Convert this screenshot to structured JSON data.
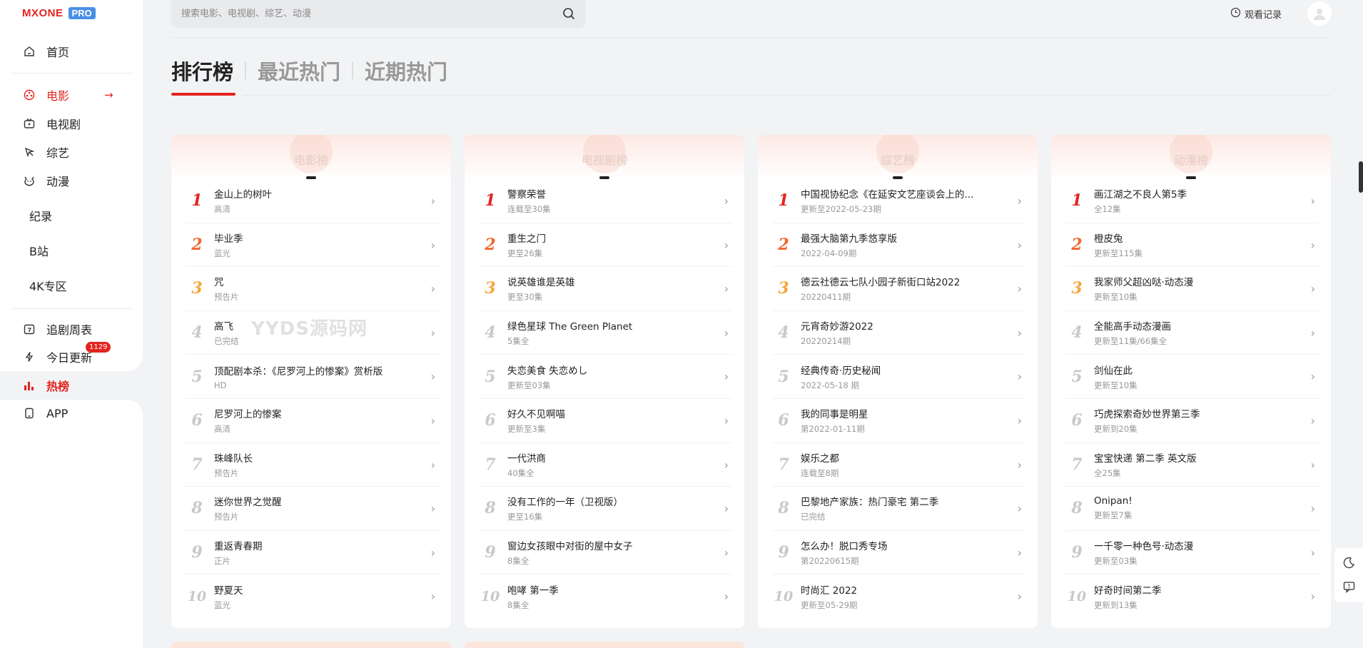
{
  "sidebar": {
    "logo": "MXONE",
    "logo_badge": "PRO",
    "items": [
      {
        "label": "首页",
        "icon": "home-icon"
      },
      {
        "label": "电影",
        "icon": "film-icon"
      },
      {
        "label": "电视剧",
        "icon": "tv-icon"
      },
      {
        "label": "综艺",
        "icon": "variety-icon"
      },
      {
        "label": "动漫",
        "icon": "anime-icon"
      },
      {
        "label": "纪录"
      },
      {
        "label": "B站"
      },
      {
        "label": "4K专区"
      },
      {
        "label": "追剧周表",
        "icon": "calendar-icon"
      },
      {
        "label": "今日更新",
        "icon": "lightning-icon",
        "badge": "1129"
      },
      {
        "label": "热榜",
        "icon": "chart-icon"
      },
      {
        "label": "APP",
        "icon": "phone-icon"
      }
    ]
  },
  "header": {
    "search_placeholder": "搜索电影、电视剧、综艺、动漫",
    "history_label": "观看记录"
  },
  "tabs": [
    "排行榜",
    "最近热门",
    "近期热门"
  ],
  "watermark": "YYDS源码网",
  "colors": {
    "accent": "#e4231e",
    "rank2": "#f2662f",
    "rank3": "#f7a63a",
    "brand_pro": "#4a8fe7"
  },
  "cards": [
    {
      "title": "电影榜",
      "items": [
        {
          "name": "金山上的树叶",
          "sub": "高清"
        },
        {
          "name": "毕业季",
          "sub": "蓝光"
        },
        {
          "name": "咒",
          "sub": "预告片"
        },
        {
          "name": "高飞",
          "sub": "已完结"
        },
        {
          "name": "顶配剧本杀：《尼罗河上的惨案》赏析版",
          "sub": "HD"
        },
        {
          "name": "尼罗河上的惨案",
          "sub": "高清"
        },
        {
          "name": "珠峰队长",
          "sub": "预告片"
        },
        {
          "name": "迷你世界之觉醒",
          "sub": "预告片"
        },
        {
          "name": "重返青春期",
          "sub": "正片"
        },
        {
          "name": "野夏天",
          "sub": "蓝光"
        }
      ]
    },
    {
      "title": "电视剧榜",
      "items": [
        {
          "name": "警察荣誉",
          "sub": "连载至30集"
        },
        {
          "name": "重生之门",
          "sub": "更至26集"
        },
        {
          "name": "说英雄谁是英雄",
          "sub": "更至30集"
        },
        {
          "name": "绿色星球 The Green Planet",
          "sub": "5集全"
        },
        {
          "name": "失恋美食 失恋めし",
          "sub": "更新至03集"
        },
        {
          "name": "好久不见啊喵",
          "sub": "更新至3集"
        },
        {
          "name": "一代洪商",
          "sub": "40集全"
        },
        {
          "name": "没有工作的一年（卫视版）",
          "sub": "更至16集"
        },
        {
          "name": "窗边女孩眼中对街的屋中女子",
          "sub": "8集全"
        },
        {
          "name": "咆哮 第一季",
          "sub": "8集全"
        }
      ]
    },
    {
      "title": "综艺榜",
      "items": [
        {
          "name": "中国视协纪念《在延安文艺座谈会上的...",
          "sub": "更新至2022-05-23期"
        },
        {
          "name": "最强大脑第九季悠享版",
          "sub": "2022-04-09期"
        },
        {
          "name": "德云社德云七队小园子新街口站2022",
          "sub": "20220411期"
        },
        {
          "name": "元宵奇妙游2022",
          "sub": "20220214期"
        },
        {
          "name": "经典传奇·历史秘闻",
          "sub": "2022-05-18 期"
        },
        {
          "name": "我的同事是明星",
          "sub": "第2022-01-11期"
        },
        {
          "name": "娱乐之都",
          "sub": "连载至8期"
        },
        {
          "name": "巴黎地产家族：热门豪宅 第二季",
          "sub": "已完结"
        },
        {
          "name": "怎么办！脱口秀专场",
          "sub": "第20220615期"
        },
        {
          "name": "时尚汇 2022",
          "sub": "更新至05-29期"
        }
      ]
    },
    {
      "title": "动漫榜",
      "items": [
        {
          "name": "画江湖之不良人第5季",
          "sub": "全12集"
        },
        {
          "name": "橙皮兔",
          "sub": "更新至115集"
        },
        {
          "name": "我家师父超凶哒·动态漫",
          "sub": "更新至10集"
        },
        {
          "name": "全能高手动态漫画",
          "sub": "更新至11集/66集全"
        },
        {
          "name": "剑仙在此",
          "sub": "更新至10集"
        },
        {
          "name": "巧虎探索奇妙世界第三季",
          "sub": "更新到20集"
        },
        {
          "name": "宝宝快递 第二季 英文版",
          "sub": "全25集"
        },
        {
          "name": "Onipan!",
          "sub": "更新至7集"
        },
        {
          "name": "一千零一种色号·动态漫",
          "sub": "更新至03集"
        },
        {
          "name": "好奇时间第二季",
          "sub": "更新到13集"
        }
      ]
    }
  ],
  "ranks": [
    "1",
    "2",
    "3",
    "4",
    "5",
    "6",
    "7",
    "8",
    "9",
    "10"
  ]
}
